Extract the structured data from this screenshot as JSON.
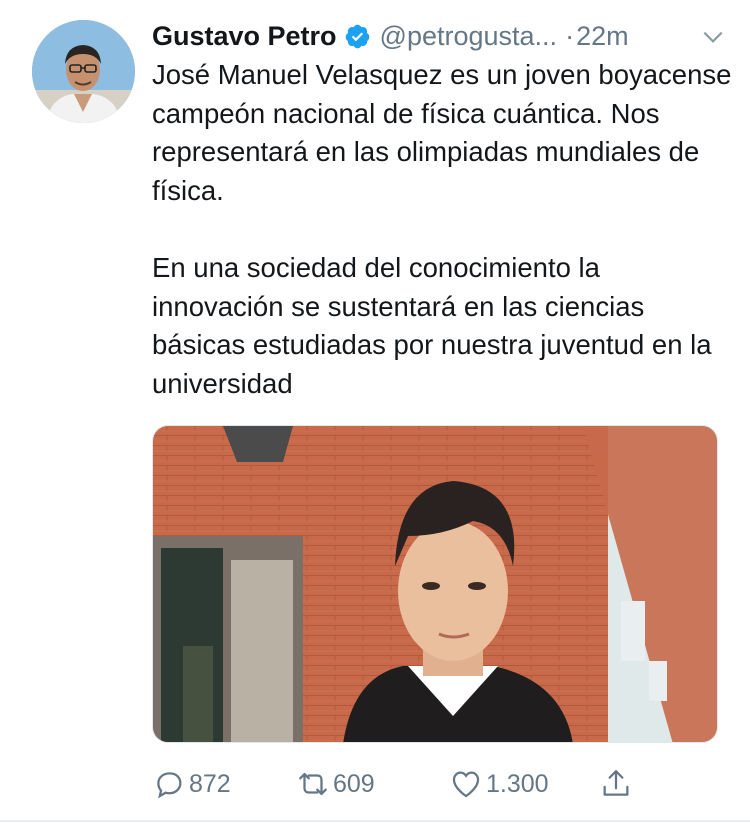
{
  "tweet": {
    "author_name": "Gustavo Petro",
    "handle": "@petrogusta...",
    "separator": "·",
    "time": "22m",
    "paragraphs": [
      "José Manuel Velasquez es un joven boyacense campeón nacional de física cuántica. Nos representará en las olimpiadas mundiales de física.",
      "En una sociedad del conocimiento la innovación se sustentará en las ciencias básicas estudiadas por nuestra juventud en la universidad"
    ]
  },
  "actions": {
    "replies": "872",
    "retweets": "609",
    "likes": "1.300"
  },
  "icons": {
    "verified": "verified-badge-icon",
    "more": "chevron-down-icon",
    "reply": "reply-icon",
    "retweet": "retweet-icon",
    "like": "heart-icon",
    "share": "share-icon"
  },
  "colors": {
    "verified_blue": "#1da1f2",
    "muted": "#657786",
    "text": "#14171a"
  }
}
